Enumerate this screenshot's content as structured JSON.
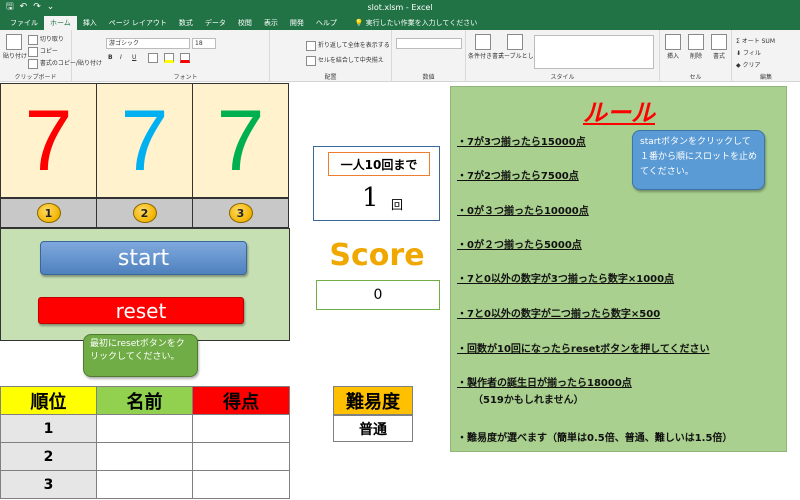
{
  "window": {
    "title": "slot.xlsm - Excel"
  },
  "qat": {
    "save": "🖫",
    "undo": "↶",
    "redo": "↷",
    "more": "⌄"
  },
  "ribbon": {
    "tabs": [
      "ファイル",
      "ホーム",
      "挿入",
      "ページ レイアウト",
      "数式",
      "データ",
      "校閲",
      "表示",
      "開発",
      "ヘルプ"
    ],
    "search": "実行したい作業を入力してください",
    "clipboard": {
      "paste": "貼り付け",
      "cut": "切り取り",
      "copy": "コピー",
      "format_painter": "書式のコピー/貼り付け",
      "label": "クリップボード"
    },
    "font": {
      "name": "游ゴシック",
      "size": "18",
      "bold": "B",
      "italic": "I",
      "underline": "U",
      "label": "フォント"
    },
    "alignment": {
      "wrap": "折り返して全体を表示する",
      "merge": "セルを結合して中央揃え",
      "label": "配置"
    },
    "number": {
      "label": "数値"
    },
    "styles": {
      "conditional": "条件付き書式",
      "table": "テーブルとして書式設定",
      "label": "スタイル"
    },
    "cells": {
      "insert": "挿入",
      "delete": "削除",
      "format": "書式",
      "label": "セル"
    },
    "editing": {
      "autosum": "オート SUM",
      "fill": "フィル",
      "clear": "クリア",
      "label": "編集"
    }
  },
  "slots": [
    {
      "digit": "7",
      "color": "#ff0000",
      "index": "1"
    },
    {
      "digit": "7",
      "color": "#00b0f0",
      "index": "2"
    },
    {
      "digit": "7",
      "color": "#00b050",
      "index": "3"
    }
  ],
  "buttons": {
    "start": "start",
    "reset": "reset"
  },
  "notes": {
    "reset_hint": "最初にresetボタンをクリックしてください。",
    "start_hint": "startボタンをクリックして１番から順にスロットを止めてください。"
  },
  "round": {
    "label": "一人10回まで",
    "value": "1",
    "unit": "回"
  },
  "score": {
    "label": "Score",
    "value": "0"
  },
  "rules": {
    "title": "ルール",
    "items": [
      "・7が3つ揃ったら15000点",
      "・7が2つ揃ったら7500点",
      "・0が３つ揃ったら10000点",
      "・0が２つ揃ったら5000点",
      "・7と0以外の数字が3つ揃ったら数字×1000点",
      "・7と0以外の数字が二つ揃ったら数字×500",
      "・回数が10回になったらresetボタンを押してください",
      "・製作者の誕生日が揃ったら18000点",
      "・難易度が選べます（簡単は0.5倍、普通、難しいは1.5倍）"
    ],
    "sub_note": "（519かもしれません）"
  },
  "ranking": {
    "headers": [
      "順位",
      "名前",
      "得点"
    ],
    "header_colors": [
      "#ffff00",
      "#92d050",
      "#ff0000"
    ],
    "rows": [
      {
        "rank": "1",
        "name": "",
        "score": ""
      },
      {
        "rank": "2",
        "name": "",
        "score": ""
      },
      {
        "rank": "3",
        "name": "",
        "score": ""
      }
    ]
  },
  "difficulty": {
    "label": "難易度",
    "value": "普通"
  }
}
